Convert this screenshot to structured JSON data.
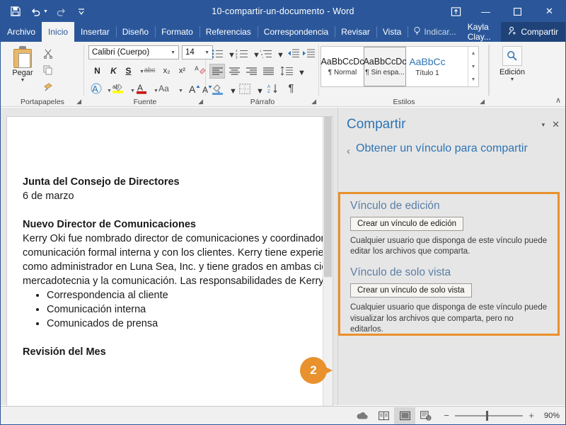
{
  "window": {
    "title": "10-compartir-un-documento  -  Word",
    "qat": [
      {
        "name": "save-icon",
        "glyph": "ὋE"
      },
      {
        "name": "undo-icon",
        "glyph": "↶"
      },
      {
        "name": "redo-icon",
        "glyph": "↻"
      },
      {
        "name": "customize-qat-icon",
        "glyph": "⌄"
      }
    ],
    "ribbon_display_options": "⤓",
    "minimize": "—",
    "maximize": "☐",
    "close": "✕",
    "accent_color": "#2b579a"
  },
  "tabs": [
    {
      "label": "Archivo",
      "active": false
    },
    {
      "label": "Inicio",
      "active": true
    },
    {
      "label": "Insertar",
      "active": false
    },
    {
      "label": "Diseño",
      "active": false
    },
    {
      "label": "Formato",
      "active": false
    },
    {
      "label": "Referencias",
      "active": false
    },
    {
      "label": "Correspondencia",
      "active": false
    },
    {
      "label": "Revisar",
      "active": false
    },
    {
      "label": "Vista",
      "active": false
    }
  ],
  "tell_me": "Indicar...",
  "account": "Kayla Clay...",
  "share_button": "Compartir",
  "ribbon": {
    "clipboard": {
      "group_label": "Portapapeles",
      "paste_label": "Pegar",
      "cut_label": "✂",
      "copy_label": "❐",
      "format_painter_label": "✎"
    },
    "font": {
      "group_label": "Fuente",
      "font_name": "Calibri (Cuerpo)",
      "font_size": "14",
      "bold": "N",
      "italic": "K",
      "underline": "S",
      "strikethrough": "abc",
      "subscript": "x₂",
      "superscript": "x²",
      "clear_format": "A",
      "text_effects": "A",
      "highlight": "ab",
      "font_color": "A",
      "change_case": "Aa",
      "grow_font": "A",
      "shrink_font": "A"
    },
    "paragraph": {
      "group_label": "Párrafo",
      "bullets": "≡",
      "numbering": "≡",
      "multilevel": "≡",
      "decrease_indent": "⇤",
      "increase_indent": "⇥",
      "align_left": "≡",
      "align_center": "≡",
      "align_right": "≡",
      "justify": "≡",
      "line_spacing": "↕",
      "shading": "◈",
      "borders": "▦",
      "sort": "A↓",
      "show_marks": "¶"
    },
    "styles": {
      "group_label": "Estilos",
      "items": [
        {
          "preview": "AaBbCcDc",
          "name": "¶ Normal",
          "selected": false,
          "title_style": false
        },
        {
          "preview": "AaBbCcDc",
          "name": "¶ Sin espa...",
          "selected": true,
          "title_style": false
        },
        {
          "preview": "AaBbCc",
          "name": "Título 1",
          "selected": false,
          "title_style": true
        }
      ]
    },
    "editing": {
      "group_label": "Edición",
      "icon": "search-icon"
    },
    "collapse_ribbon": "∧"
  },
  "document": {
    "heading1": "Junta del Consejo de Directores",
    "date": "6 de marzo",
    "heading2": "Nuevo Director de Comunicaciones",
    "paragraph_lines": [
      "Kerry Oki fue nombrado director de comunicaciones y coordinador",
      "comunicación formal interna y con los clientes. Kerry tiene experiencia",
      "como administrador en Luna Sea, Inc. y tiene grados en ambas ciencias,",
      "mercadotecnia y la comunicación. Las responsabilidades de Kerry"
    ],
    "bullets": [
      "Correspondencia al cliente",
      "Comunicación interna",
      "Comunicados de prensa"
    ],
    "heading3": "Revisión del Mes"
  },
  "share_pane": {
    "title": "Compartir",
    "collapse_icon": "▾",
    "close_icon": "✕",
    "back_icon": "‹",
    "subtitle": "Obtener un vínculo para compartir",
    "sections": [
      {
        "title": "Vínculo de edición",
        "button": "Crear un vínculo de edición",
        "description": "Cualquier usuario que disponga de este vínculo puede editar los archivos que comparta."
      },
      {
        "title": "Vínculo de solo vista",
        "button": "Crear un vínculo de solo vista",
        "description": "Cualquier usuario que disponga de este vínculo puede visualizar los archivos que comparta, pero no editarlos."
      }
    ],
    "highlight_color": "#e8912d"
  },
  "callout": {
    "number": "2",
    "color": "#e8912d"
  },
  "statusbar": {
    "icons": [
      {
        "name": "onedrive-icon",
        "glyph": "☁",
        "selected": false
      },
      {
        "name": "read-mode-icon",
        "glyph": "☷",
        "selected": false
      },
      {
        "name": "print-layout-icon",
        "glyph": "☰",
        "selected": true
      },
      {
        "name": "web-layout-icon",
        "glyph": "☲",
        "selected": false
      }
    ],
    "zoom_out": "−",
    "zoom_in": "+",
    "zoom_level": "90%"
  }
}
